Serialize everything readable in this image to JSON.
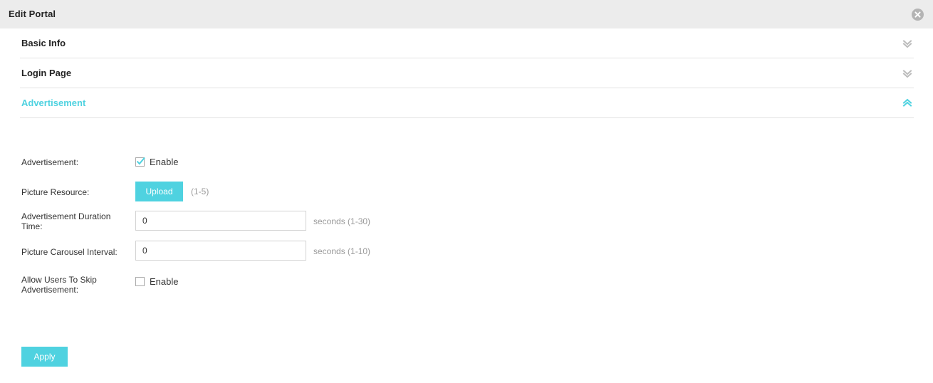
{
  "window": {
    "title": "Edit Portal",
    "close_icon": "close-circle-icon"
  },
  "accent_color": "#4fd2e0",
  "sections": [
    {
      "label": "Basic Info",
      "state": "collapsed",
      "icon": "chevron-double-down-icon"
    },
    {
      "label": "Login Page",
      "state": "collapsed",
      "icon": "chevron-double-down-icon"
    },
    {
      "label": "Advertisement",
      "state": "expanded",
      "icon": "chevron-double-up-icon"
    }
  ],
  "form": {
    "advertisement": {
      "label": "Advertisement:",
      "checkbox_label": "Enable",
      "checked": true
    },
    "picture_resource": {
      "label": "Picture Resource:",
      "button_label": "Upload",
      "hint": "(1-5)"
    },
    "duration_time": {
      "label": "Advertisement Duration Time:",
      "value": "0",
      "placeholder": "",
      "unit": "seconds (1-30)"
    },
    "carousel_interval": {
      "label": "Picture Carousel Interval:",
      "value": "0",
      "placeholder": "",
      "unit": "seconds (1-10)"
    },
    "allow_skip": {
      "label": "Allow Users To Skip Advertisement:",
      "checkbox_label": "Enable",
      "checked": false
    }
  },
  "footer": {
    "apply_label": "Apply"
  }
}
